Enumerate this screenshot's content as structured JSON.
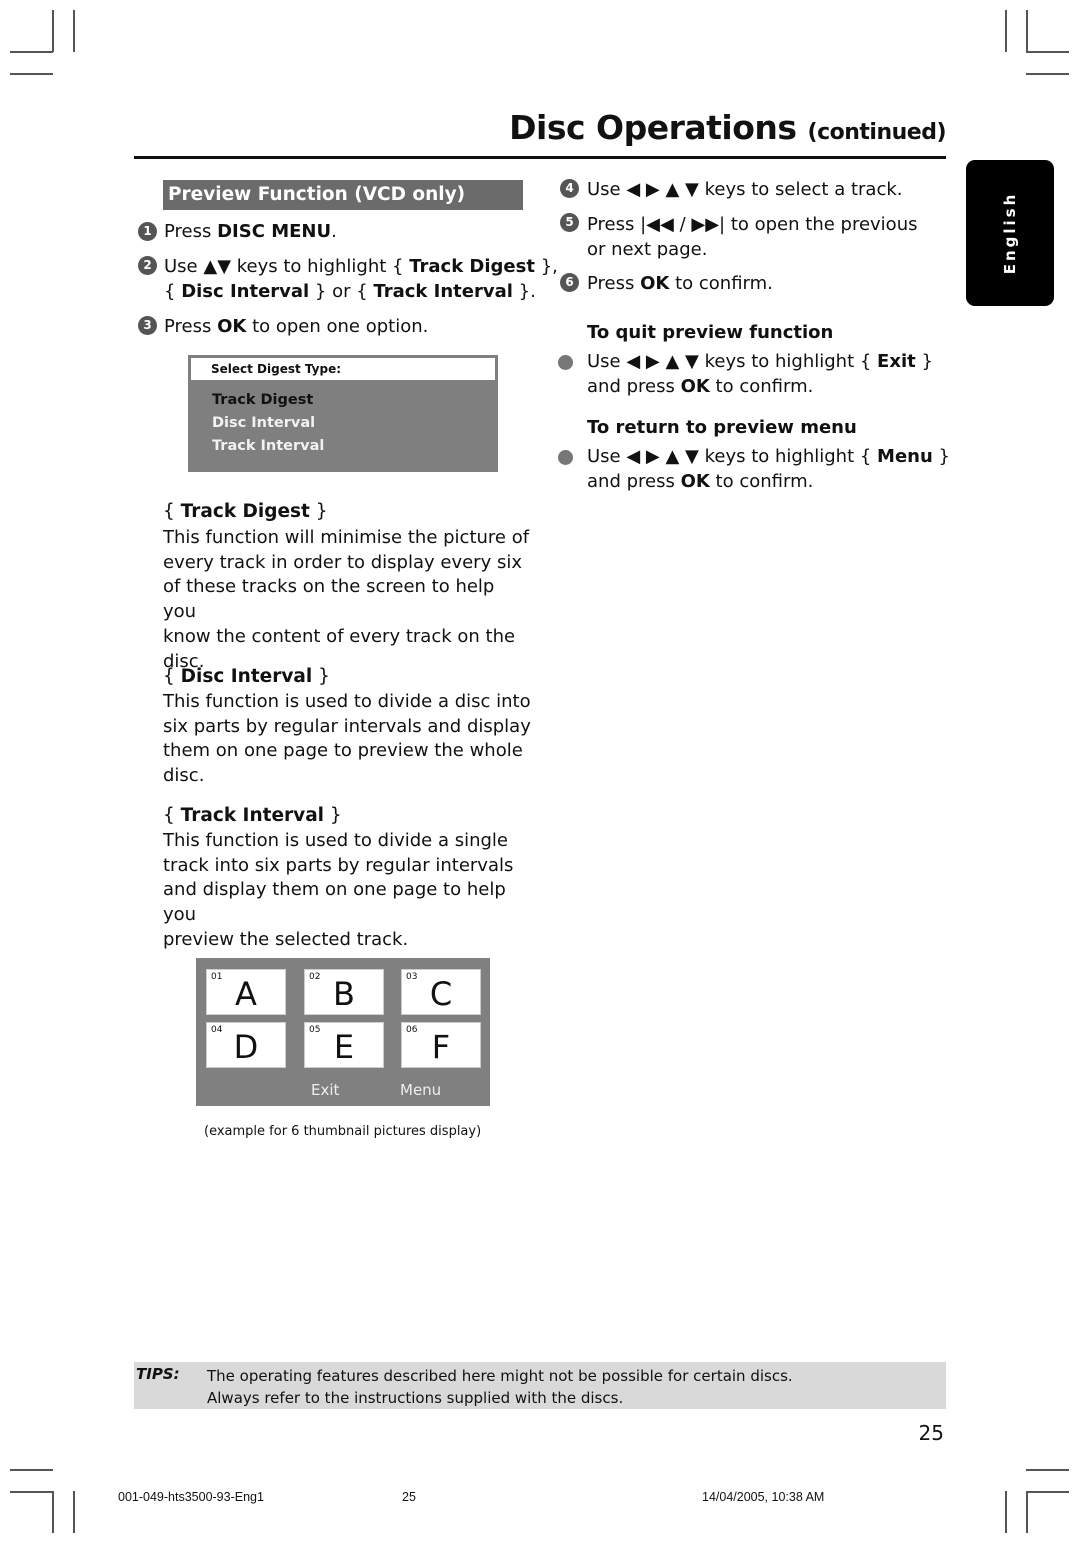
{
  "header": {
    "title": "Disc Operations",
    "title_suffix": "(continued)",
    "language_tab": "English"
  },
  "left_column": {
    "section_heading": "Preview Function (VCD only)",
    "steps": [
      {
        "number": "1",
        "parts": [
          "Press ",
          "DISC MENU",
          "."
        ]
      },
      {
        "number": "2",
        "line1": [
          "Use ▲▼ keys to highlight { ",
          "Track Digest",
          " },"
        ],
        "line2": [
          "{ ",
          "Disc Interval",
          " } or { ",
          "Track Interval",
          " }."
        ]
      },
      {
        "number": "3",
        "parts": [
          "Press ",
          "OK",
          " to open one option."
        ]
      }
    ],
    "digest_menu": {
      "header": "Select Digest Type:",
      "items": [
        {
          "label": "Track Digest",
          "selected": true
        },
        {
          "label": "Disc Interval",
          "selected": false
        },
        {
          "label": "Track Interval",
          "selected": false
        }
      ]
    },
    "options": [
      {
        "title": "Track Digest",
        "lines": [
          "This function will minimise the picture of",
          "every track in order to display every six",
          "of these tracks on the screen to help you",
          "know the content of every track on the",
          "disc."
        ]
      },
      {
        "title": "Disc Interval",
        "lines": [
          "This function is used to divide a disc into",
          "six parts by regular intervals and display",
          "them on one page to preview the whole",
          "disc."
        ]
      },
      {
        "title": "Track Interval",
        "lines": [
          "This function is used to divide a single",
          "track into six parts by regular intervals",
          "and display them on one page to help you",
          "preview the selected track."
        ]
      }
    ],
    "thumbnail_example": {
      "thumbnails": [
        {
          "index": "01",
          "letter": "A"
        },
        {
          "index": "02",
          "letter": "B"
        },
        {
          "index": "03",
          "letter": "C"
        },
        {
          "index": "04",
          "letter": "D"
        },
        {
          "index": "05",
          "letter": "E"
        },
        {
          "index": "06",
          "letter": "F"
        }
      ],
      "exit_label": "Exit",
      "menu_label": "Menu",
      "caption": "(example for 6 thumbnail pictures display)"
    }
  },
  "right_column": {
    "steps": [
      {
        "number": "4",
        "parts": [
          "Use ◀ ▶ ▲ ▼ keys to select a track."
        ]
      },
      {
        "number": "5",
        "line1": "Press |◀◀ / ▶▶| to open the previous",
        "line2": "or next page."
      },
      {
        "number": "6",
        "parts": [
          "Press ",
          "OK",
          " to confirm."
        ]
      }
    ],
    "quit": {
      "heading": "To quit preview function",
      "line1": [
        "Use ◀ ▶ ▲ ▼ keys to highlight { ",
        "Exit",
        " }"
      ],
      "line2": [
        "and press ",
        "OK",
        " to confirm."
      ]
    },
    "return": {
      "heading": "To return to preview menu",
      "line1": [
        "Use ◀ ▶ ▲ ▼ keys to highlight { ",
        "Menu",
        " }"
      ],
      "line2": [
        "and press ",
        "OK",
        " to confirm."
      ]
    }
  },
  "tips": {
    "label": "TIPS:",
    "lines": [
      "The operating features described here might not be possible for certain discs.",
      "Always refer to the instructions supplied with the discs."
    ]
  },
  "page_number": "25",
  "footer": {
    "file": "001-049-hts3500-93-Eng1",
    "page": "25",
    "timestamp": "14/04/2005, 10:38 AM"
  }
}
